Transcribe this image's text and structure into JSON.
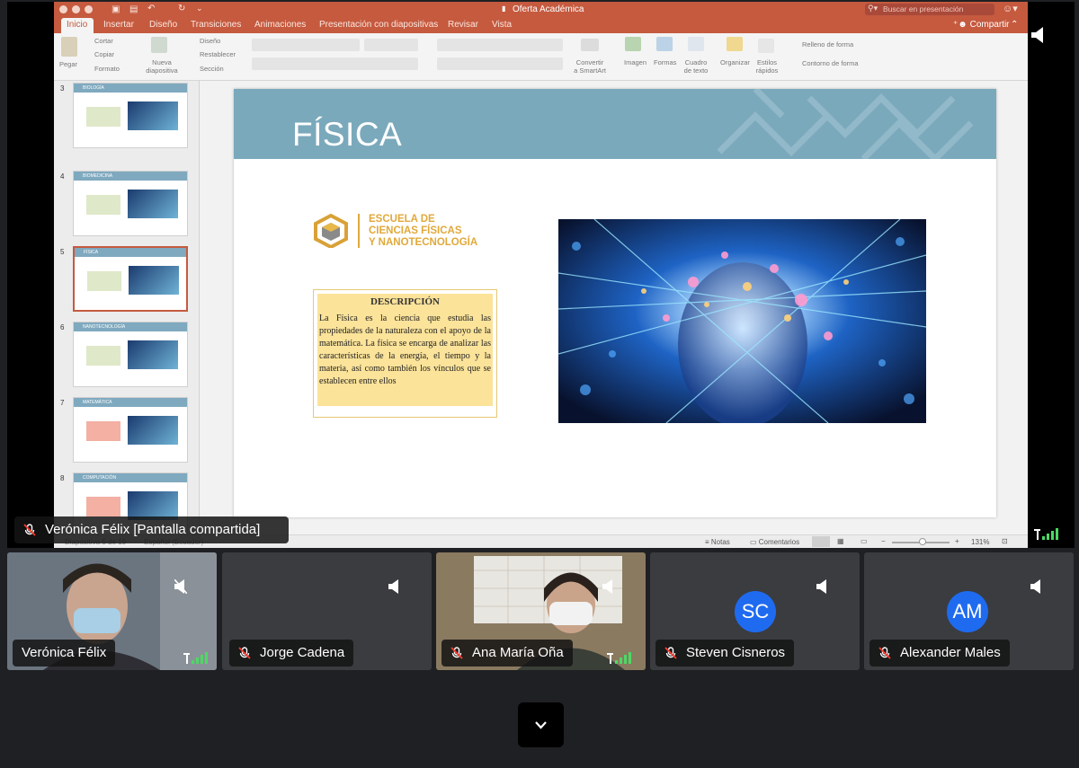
{
  "window": {
    "title": "Oferta Académica",
    "search_placeholder": "Buscar en presentación"
  },
  "ribbon_tabs": [
    "Inicio",
    "Insertar",
    "Diseño",
    "Transiciones",
    "Animaciones",
    "Presentación con diapositivas",
    "Revisar",
    "Vista"
  ],
  "share_label": "Compartir",
  "ribbon": {
    "pegar": "Pegar",
    "cortar": "Cortar",
    "copiar": "Copiar",
    "formato": "Formato",
    "nueva_diapositiva": "Nueva diapositiva",
    "diseno": "Diseño",
    "restablecer": "Restablecer",
    "seccion": "Sección",
    "convertir": "Convertir a SmartArt",
    "imagen": "Imagen",
    "formas": "Formas",
    "cuadro": "Cuadro de texto",
    "organizar": "Organizar",
    "estilos": "Estilos rápidos",
    "relleno": "Relleno de forma",
    "contorno": "Contorno de forma"
  },
  "thumbnails": [
    {
      "num": "3",
      "title": "BIOLOGÍA"
    },
    {
      "num": "4",
      "title": "BIOMEDICINA"
    },
    {
      "num": "5",
      "title": "FÍSICA",
      "selected": true
    },
    {
      "num": "6",
      "title": "NANOTECNOLOGÍA"
    },
    {
      "num": "7",
      "title": "MATEMÁTICA"
    },
    {
      "num": "8",
      "title": "COMPUTACIÓN"
    }
  ],
  "slide": {
    "title": "FÍSICA",
    "school_lines": [
      "ESCUELA DE",
      "CIENCIAS FÍSICAS",
      "Y NANOTECNOLOGÍA"
    ],
    "desc_title": "DESCRIPCIÓN",
    "desc_body": "La Física es la ciencia que estudia las propiedades de la naturaleza con el apoyo de la matemática. La física se encarga de analizar las características de la energía, el tiempo y la materia, así como también los vínculos que se establecen entre ellos"
  },
  "statusbar": {
    "slide_info": "Diapositiva 5 de 19",
    "language": "Español (Ecuador)",
    "notas": "Notas",
    "comentarios": "Comentarios",
    "zoom": "131%"
  },
  "presenter_label": "Verónica Félix [Pantalla compartida]",
  "participants": [
    {
      "name": "Verónica Félix",
      "muted": false,
      "video": true
    },
    {
      "name": "Jorge Cadena",
      "muted": true,
      "video": false
    },
    {
      "name": "Ana María Oña",
      "muted": true,
      "video": true
    },
    {
      "name": "Steven Cisneros",
      "muted": true,
      "video": false,
      "initials": "SC"
    },
    {
      "name": "Alexander Males",
      "muted": true,
      "video": false,
      "initials": "AM"
    }
  ],
  "colors": {
    "ppt_accent": "#c55a3f",
    "slide_header": "#7ba9bc",
    "desc_fill": "#fbe39a",
    "avatar": "#1f6bf0"
  }
}
